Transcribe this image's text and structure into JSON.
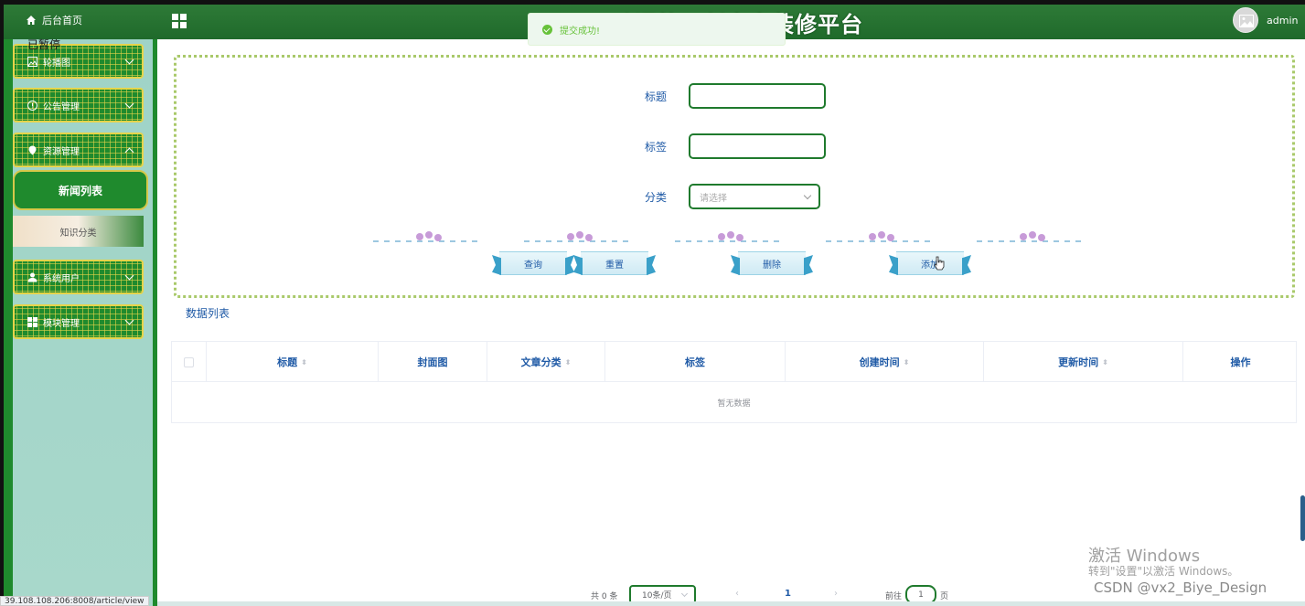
{
  "header": {
    "home_label": "后台首页",
    "site_title": "动漫第三创意家装修平台",
    "user_name": "admin"
  },
  "toast": {
    "message": "提交成功!"
  },
  "overlay": {
    "paused_text": "已暂停"
  },
  "sidebar": {
    "items": [
      {
        "label": "轮播图",
        "icon": "image-icon"
      },
      {
        "label": "公告管理",
        "icon": "info-icon"
      },
      {
        "label": "资源管理",
        "icon": "location-icon",
        "expanded": true
      },
      {
        "label": "系统用户",
        "icon": "user-icon"
      },
      {
        "label": "模块管理",
        "icon": "grid-icon"
      }
    ],
    "submenu": [
      {
        "label": "新闻列表",
        "active": true
      },
      {
        "label": "知识分类",
        "active": false
      }
    ]
  },
  "search": {
    "title_label": "标题",
    "tag_label": "标签",
    "category_label": "分类",
    "category_placeholder": "请选择",
    "buttons": {
      "query": "查询",
      "reset": "重置",
      "delete": "删除",
      "add": "添加"
    }
  },
  "list": {
    "title": "数据列表",
    "columns": [
      "标题",
      "封面图",
      "文章分类",
      "标签",
      "创建时间",
      "更新时间",
      "操作"
    ],
    "empty_text": "暂无数据"
  },
  "pagination": {
    "total": "共 0 条",
    "page_size": "10条/页",
    "current_page": "1",
    "goto_label": "前往",
    "goto_value": "1",
    "page_suffix": "页"
  },
  "watermark": {
    "line1": "激活 Windows",
    "line2": "转到\"设置\"以激活 Windows。",
    "csdn": "CSDN @vx2_Biye_Design"
  },
  "status_bar": {
    "url": "39.108.108.206:8008/article/view"
  },
  "colors": {
    "header_green": "#1f6a2b",
    "accent_blue": "#1f5aa6",
    "border_green": "#1f7a2d",
    "success": "#67c23a"
  }
}
